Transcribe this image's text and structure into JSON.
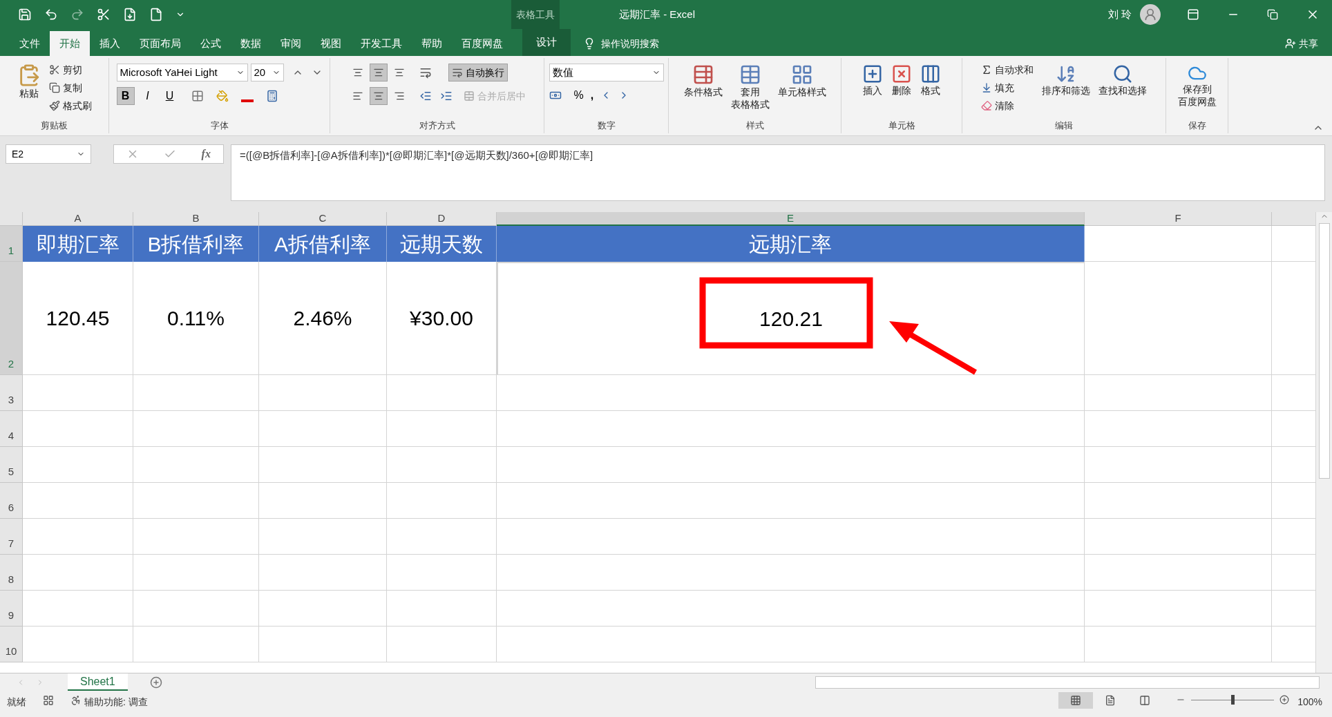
{
  "title_bar": {
    "context_label": "表格工具",
    "title": "远期汇率 - Excel",
    "user": "刘 玲"
  },
  "ribbon_tabs": [
    {
      "label": "文件",
      "selected": false
    },
    {
      "label": "开始",
      "selected": true
    },
    {
      "label": "插入",
      "selected": false
    },
    {
      "label": "页面布局",
      "selected": false
    },
    {
      "label": "公式",
      "selected": false
    },
    {
      "label": "数据",
      "selected": false
    },
    {
      "label": "审阅",
      "selected": false
    },
    {
      "label": "视图",
      "selected": false
    },
    {
      "label": "开发工具",
      "selected": false
    },
    {
      "label": "帮助",
      "selected": false
    },
    {
      "label": "百度网盘",
      "selected": false
    },
    {
      "label": "设计",
      "selected": false
    }
  ],
  "tell_me": "操作说明搜索",
  "share": "共享",
  "clipboard": {
    "paste": "粘贴",
    "cut": "剪切",
    "copy": "复制",
    "format_painter": "格式刷",
    "group": "剪贴板"
  },
  "font": {
    "name": "Microsoft YaHei Light",
    "size": "20",
    "styles": [
      {
        "label": "B",
        "pressed": true
      },
      {
        "label": "I",
        "pressed": false
      },
      {
        "label": "U",
        "pressed": false
      }
    ],
    "group": "字体"
  },
  "alignment": {
    "vertical": [
      {
        "pressed": false
      },
      {
        "pressed": true
      },
      {
        "pressed": false
      }
    ],
    "horizontal": [
      {
        "pressed": false
      },
      {
        "pressed": true
      },
      {
        "pressed": false
      }
    ],
    "wrap_text": {
      "label": "自动换行",
      "pressed": true
    },
    "merge": {
      "label": "合并后居中",
      "disabled": true
    },
    "group": "对齐方式"
  },
  "number": {
    "format": "数值",
    "percent": "%",
    "comma": ",",
    "group": "数字"
  },
  "styles": {
    "buttons": [
      {
        "lines": [
          "条件格式"
        ]
      },
      {
        "lines": [
          "套用",
          "表格格式"
        ]
      },
      {
        "lines": [
          "单元格样式"
        ]
      }
    ],
    "group": "样式"
  },
  "cells": {
    "buttons": [
      "插入",
      "删除",
      "格式"
    ],
    "group": "单元格"
  },
  "editing": {
    "autosum": "自动求和",
    "fill": "填充",
    "clear": "清除",
    "sort": "排序和筛选",
    "find": "查找和选择",
    "group": "编辑"
  },
  "save": {
    "lines": [
      "保存到",
      "百度网盘"
    ],
    "group": "保存"
  },
  "formula_bar": {
    "name_box": "E2",
    "function_label": "fx",
    "formula": "=([@B拆借利率]-[@A拆借利率])*[@即期汇率]*[@远期天数]/360+[@即期汇率]"
  },
  "columns": [
    {
      "label": "A",
      "selected": false
    },
    {
      "label": "B",
      "selected": false
    },
    {
      "label": "C",
      "selected": false
    },
    {
      "label": "D",
      "selected": false
    },
    {
      "label": "E",
      "selected": true
    },
    {
      "label": "F",
      "selected": false
    }
  ],
  "rows": [
    {
      "label": "1",
      "selected": true
    },
    {
      "label": "2",
      "selected": true
    },
    {
      "label": "3",
      "selected": false
    },
    {
      "label": "4",
      "selected": false
    },
    {
      "label": "5",
      "selected": false
    },
    {
      "label": "6",
      "selected": false
    },
    {
      "label": "7",
      "selected": false
    },
    {
      "label": "8",
      "selected": false
    },
    {
      "label": "9",
      "selected": false
    },
    {
      "label": "10",
      "selected": false
    }
  ],
  "table": {
    "headers": [
      "即期汇率",
      "B拆借利率",
      "A拆借利率",
      "远期天数",
      "远期汇率"
    ],
    "values": [
      "120.45",
      "0.11%",
      "2.46%",
      "¥30.00",
      "120.21"
    ]
  },
  "sheet_tabs": [
    {
      "label": "Sheet1",
      "selected": true
    }
  ],
  "status_bar": {
    "mode": "就绪",
    "accessibility": "辅助功能: 调查",
    "views": [
      {
        "kind": "normal",
        "selected": true
      },
      {
        "kind": "page_layout",
        "selected": false
      },
      {
        "kind": "page_break",
        "selected": false
      }
    ],
    "zoom_slider": {
      "level": 0.5
    },
    "zoom": "100%"
  }
}
